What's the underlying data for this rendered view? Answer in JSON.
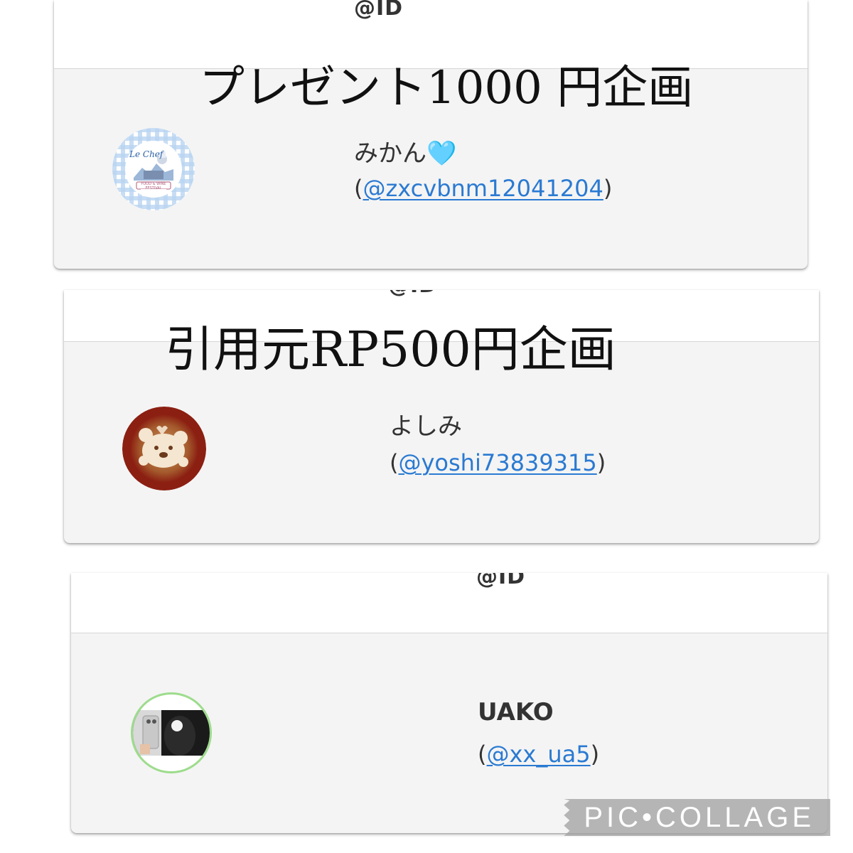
{
  "cards": [
    {
      "top_id_label": "@ID",
      "overlay_title": "プレゼント1000 円企画",
      "user_name": "みかん",
      "user_name_emoji": "🩵",
      "handle_open": "(",
      "handle": "@zxcvbnm12041204",
      "handle_close": ")",
      "avatar_text_top": "Le Chef",
      "avatar_text_bottom": "FOOD & WINE FESTIVAL"
    },
    {
      "top_id_label": "@ID",
      "overlay_title": "引用元RP500円企画",
      "user_name": "よしみ",
      "handle_open": "(",
      "handle": "@yoshi73839315",
      "handle_close": ")"
    },
    {
      "top_id_label": "@ID",
      "user_name": "UAKO",
      "handle_open": "(",
      "handle": "@xx_ua5",
      "handle_close": ")"
    }
  ],
  "watermark": "PIC•COLLAGE",
  "colors": {
    "link": "#2a7ad2",
    "card_bg": "#f4f4f4",
    "avatar_ring_green": "#9ddc8c"
  }
}
